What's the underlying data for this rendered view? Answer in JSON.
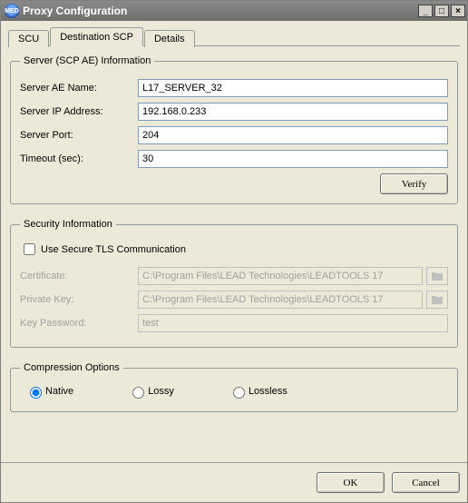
{
  "window": {
    "title": "Proxy Configuration",
    "icon_text": "MED"
  },
  "tabs": {
    "scu": "SCU",
    "dest": "Destination SCP",
    "details": "Details"
  },
  "server_group": {
    "legend": "Server (SCP AE) Information",
    "ae_label": "Server AE Name:",
    "ae_value": "L17_SERVER_32",
    "ip_label": "Server IP Address:",
    "ip_value": "192.168.0.233",
    "port_label": "Server Port:",
    "port_value": "204",
    "timeout_label": "Timeout (sec):",
    "timeout_value": "30",
    "verify_btn": "Verify"
  },
  "security_group": {
    "legend": "Security Information",
    "tls_label": "Use Secure TLS Communication",
    "cert_label": "Certificate:",
    "cert_value": "C:\\Program Files\\LEAD Technologies\\LEADTOOLS 17",
    "key_label": "Private Key:",
    "key_value": "C:\\Program Files\\LEAD Technologies\\LEADTOOLS 17",
    "pwd_label": "Key Password:",
    "pwd_value": "test"
  },
  "compression_group": {
    "legend": "Compression Options",
    "native": "Native",
    "lossy": "Lossy",
    "lossless": "Lossless"
  },
  "buttons": {
    "ok": "OK",
    "cancel": "Cancel"
  }
}
